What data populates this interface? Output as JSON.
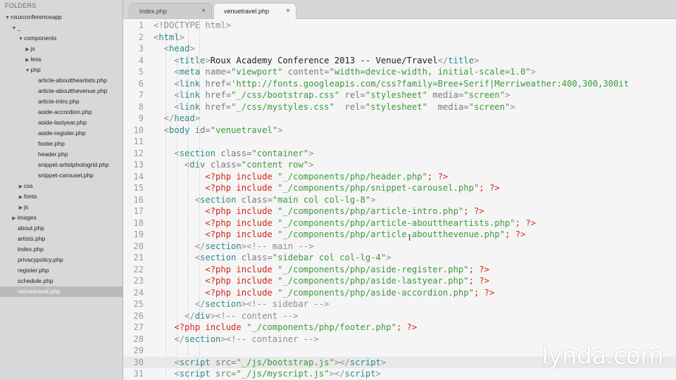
{
  "sidebar": {
    "header": "FOLDERS",
    "items": [
      {
        "label": "rouxconferenceapp",
        "depth": 0,
        "arrow": "open"
      },
      {
        "label": "_",
        "depth": 1,
        "arrow": "open"
      },
      {
        "label": "components",
        "depth": 2,
        "arrow": "open"
      },
      {
        "label": "js",
        "depth": 3,
        "arrow": "closed"
      },
      {
        "label": "less",
        "depth": 3,
        "arrow": "closed"
      },
      {
        "label": "php",
        "depth": 3,
        "arrow": "open"
      },
      {
        "label": "article-abouttheartists.php",
        "depth": 5,
        "arrow": "none"
      },
      {
        "label": "article-aboutthevenue.php",
        "depth": 5,
        "arrow": "none"
      },
      {
        "label": "article-intro.php",
        "depth": 5,
        "arrow": "none"
      },
      {
        "label": "aside-accordion.php",
        "depth": 5,
        "arrow": "none"
      },
      {
        "label": "aside-lastyear.php",
        "depth": 5,
        "arrow": "none"
      },
      {
        "label": "aside-register.php",
        "depth": 5,
        "arrow": "none"
      },
      {
        "label": "footer.php",
        "depth": 5,
        "arrow": "none"
      },
      {
        "label": "header.php",
        "depth": 5,
        "arrow": "none"
      },
      {
        "label": "snippet-artistphotogrid.php",
        "depth": 5,
        "arrow": "none"
      },
      {
        "label": "snippet-carousel.php",
        "depth": 5,
        "arrow": "none"
      },
      {
        "label": "css",
        "depth": 2,
        "arrow": "closed"
      },
      {
        "label": "fonts",
        "depth": 2,
        "arrow": "closed"
      },
      {
        "label": "js",
        "depth": 2,
        "arrow": "closed"
      },
      {
        "label": "images",
        "depth": 1,
        "arrow": "closed"
      },
      {
        "label": "about.php",
        "depth": 2,
        "arrow": "none"
      },
      {
        "label": "artists.php",
        "depth": 2,
        "arrow": "none"
      },
      {
        "label": "index.php",
        "depth": 2,
        "arrow": "none"
      },
      {
        "label": "privacypolicy.php",
        "depth": 2,
        "arrow": "none"
      },
      {
        "label": "register.php",
        "depth": 2,
        "arrow": "none"
      },
      {
        "label": "schedule.php",
        "depth": 2,
        "arrow": "none"
      },
      {
        "label": "venuetravel.php",
        "depth": 2,
        "arrow": "none",
        "selected": true
      }
    ]
  },
  "tabs": [
    {
      "label": "index.php",
      "active": false,
      "close": "×"
    },
    {
      "label": "venuetravel.php",
      "active": true,
      "close": "×"
    }
  ],
  "editor": {
    "current_line": 30,
    "lines": [
      [
        [
          "t",
          "<!DOCTYPE html>"
        ]
      ],
      [
        [
          "t",
          "<"
        ],
        [
          "tn",
          "html"
        ],
        [
          "t",
          ">"
        ]
      ],
      [
        [
          "t",
          "  <"
        ],
        [
          "tn",
          "head"
        ],
        [
          "t",
          ">"
        ]
      ],
      [
        [
          "t",
          "    <"
        ],
        [
          "tn",
          "title"
        ],
        [
          "t",
          ">"
        ],
        [
          "pt",
          "Roux Academy Conference 2013 -- Venue/Travel"
        ],
        [
          "t",
          "</"
        ],
        [
          "tn",
          "title"
        ],
        [
          "t",
          ">"
        ]
      ],
      [
        [
          "t",
          "    <"
        ],
        [
          "tn",
          "meta"
        ],
        [
          "at",
          " name="
        ],
        [
          "s",
          "\"viewport\""
        ],
        [
          "at",
          " content="
        ],
        [
          "s",
          "\"width=device-width, initial-scale=1.0\""
        ],
        [
          "t",
          ">"
        ]
      ],
      [
        [
          "t",
          "    <"
        ],
        [
          "tn",
          "link"
        ],
        [
          "at",
          " href="
        ],
        [
          "s",
          "'http://fonts.googleapis.com/css?family=Bree+Serif|Merriweather:400,300,300it"
        ]
      ],
      [
        [
          "t",
          "    <"
        ],
        [
          "tn",
          "link"
        ],
        [
          "at",
          " href="
        ],
        [
          "s",
          "\"_/css/bootstrap.css\""
        ],
        [
          "at",
          " rel="
        ],
        [
          "s",
          "\"stylesheet\""
        ],
        [
          "at",
          " media="
        ],
        [
          "s",
          "\"screen\""
        ],
        [
          "t",
          ">"
        ]
      ],
      [
        [
          "t",
          "    <"
        ],
        [
          "tn",
          "link"
        ],
        [
          "at",
          " href="
        ],
        [
          "s",
          "\"_/css/mystyles.css\""
        ],
        [
          "at",
          "  rel="
        ],
        [
          "s",
          "\"stylesheet\""
        ],
        [
          "at",
          "  media="
        ],
        [
          "s",
          "\"screen\""
        ],
        [
          "t",
          ">"
        ]
      ],
      [
        [
          "t",
          "  </"
        ],
        [
          "tn",
          "head"
        ],
        [
          "t",
          ">"
        ]
      ],
      [
        [
          "t",
          "  <"
        ],
        [
          "tn",
          "body"
        ],
        [
          "at",
          " id="
        ],
        [
          "s",
          "\"venuetravel\""
        ],
        [
          "t",
          ">"
        ]
      ],
      [],
      [
        [
          "t",
          "    <"
        ],
        [
          "tn",
          "section"
        ],
        [
          "at",
          " class="
        ],
        [
          "s",
          "\"container\""
        ],
        [
          "t",
          ">"
        ]
      ],
      [
        [
          "t",
          "      <"
        ],
        [
          "tn",
          "div"
        ],
        [
          "at",
          " class="
        ],
        [
          "s",
          "\"content row\""
        ],
        [
          "t",
          ">"
        ]
      ],
      [
        [
          "php",
          "          <?php include "
        ],
        [
          "s",
          "\"_/components/php/header.php\""
        ],
        [
          "php",
          "; ?>"
        ]
      ],
      [
        [
          "php",
          "          <?php include "
        ],
        [
          "s",
          "\"_/components/php/snippet-carousel.php\""
        ],
        [
          "php",
          "; ?>"
        ]
      ],
      [
        [
          "t",
          "        <"
        ],
        [
          "tn",
          "section"
        ],
        [
          "at",
          " class="
        ],
        [
          "s",
          "\"main col col-lg-8\""
        ],
        [
          "t",
          ">"
        ]
      ],
      [
        [
          "php",
          "          <?php include "
        ],
        [
          "s",
          "\"_/components/php/article-intro.php\""
        ],
        [
          "php",
          "; ?>"
        ]
      ],
      [
        [
          "php",
          "          <?php include "
        ],
        [
          "s",
          "\"_/components/php/article-abouttheartists.php\""
        ],
        [
          "php",
          "; ?>"
        ]
      ],
      [
        [
          "php",
          "          <?php include "
        ],
        [
          "s",
          "\"_/components/php/article-aboutthevenue.php\""
        ],
        [
          "php",
          "; ?>"
        ]
      ],
      [
        [
          "t",
          "        </"
        ],
        [
          "tn",
          "section"
        ],
        [
          "t",
          ">"
        ],
        [
          "c",
          "<!-- main -->"
        ]
      ],
      [
        [
          "t",
          "        <"
        ],
        [
          "tn",
          "section"
        ],
        [
          "at",
          " class="
        ],
        [
          "s",
          "\"sidebar col col-lg-4\""
        ],
        [
          "t",
          ">"
        ]
      ],
      [
        [
          "php",
          "          <?php include "
        ],
        [
          "s",
          "\"_/components/php/aside-register.php\""
        ],
        [
          "php",
          "; ?>"
        ]
      ],
      [
        [
          "php",
          "          <?php include "
        ],
        [
          "s",
          "\"_/components/php/aside-lastyear.php\""
        ],
        [
          "php",
          "; ?>"
        ]
      ],
      [
        [
          "php",
          "          <?php include "
        ],
        [
          "s",
          "\"_/components/php/aside-accordion.php\""
        ],
        [
          "php",
          "; ?>"
        ]
      ],
      [
        [
          "t",
          "        </"
        ],
        [
          "tn",
          "section"
        ],
        [
          "t",
          ">"
        ],
        [
          "c",
          "<!-- sidebar -->"
        ]
      ],
      [
        [
          "t",
          "      </"
        ],
        [
          "tn",
          "div"
        ],
        [
          "t",
          ">"
        ],
        [
          "c",
          "<!-- content -->"
        ]
      ],
      [
        [
          "php",
          "    <?php include "
        ],
        [
          "s",
          "\"_/components/php/footer.php\""
        ],
        [
          "php",
          "; ?>"
        ]
      ],
      [
        [
          "t",
          "    </"
        ],
        [
          "tn",
          "section"
        ],
        [
          "t",
          ">"
        ],
        [
          "c",
          "<!-- container -->"
        ]
      ],
      [],
      [
        [
          "t",
          "    <"
        ],
        [
          "tn",
          "script"
        ],
        [
          "at",
          " src="
        ],
        [
          "s",
          "\"_/js/bootstrap.js\""
        ],
        [
          "t",
          "></"
        ],
        [
          "tn",
          "script"
        ],
        [
          "t",
          ">"
        ]
      ],
      [
        [
          "t",
          "    <"
        ],
        [
          "tn",
          "script"
        ],
        [
          "at",
          " src="
        ],
        [
          "s",
          "\"_/js/myscript.js\""
        ],
        [
          "t",
          "></"
        ],
        [
          "tn",
          "script"
        ],
        [
          "t",
          ">"
        ]
      ]
    ]
  },
  "watermark": "lynda.com",
  "colors": {
    "sidebar_bg": "#d8d8d8",
    "editor_bg": "#f5f5f5",
    "tag": "#2f8a8a",
    "string": "#3b9a3b",
    "php": "#d0261a"
  }
}
